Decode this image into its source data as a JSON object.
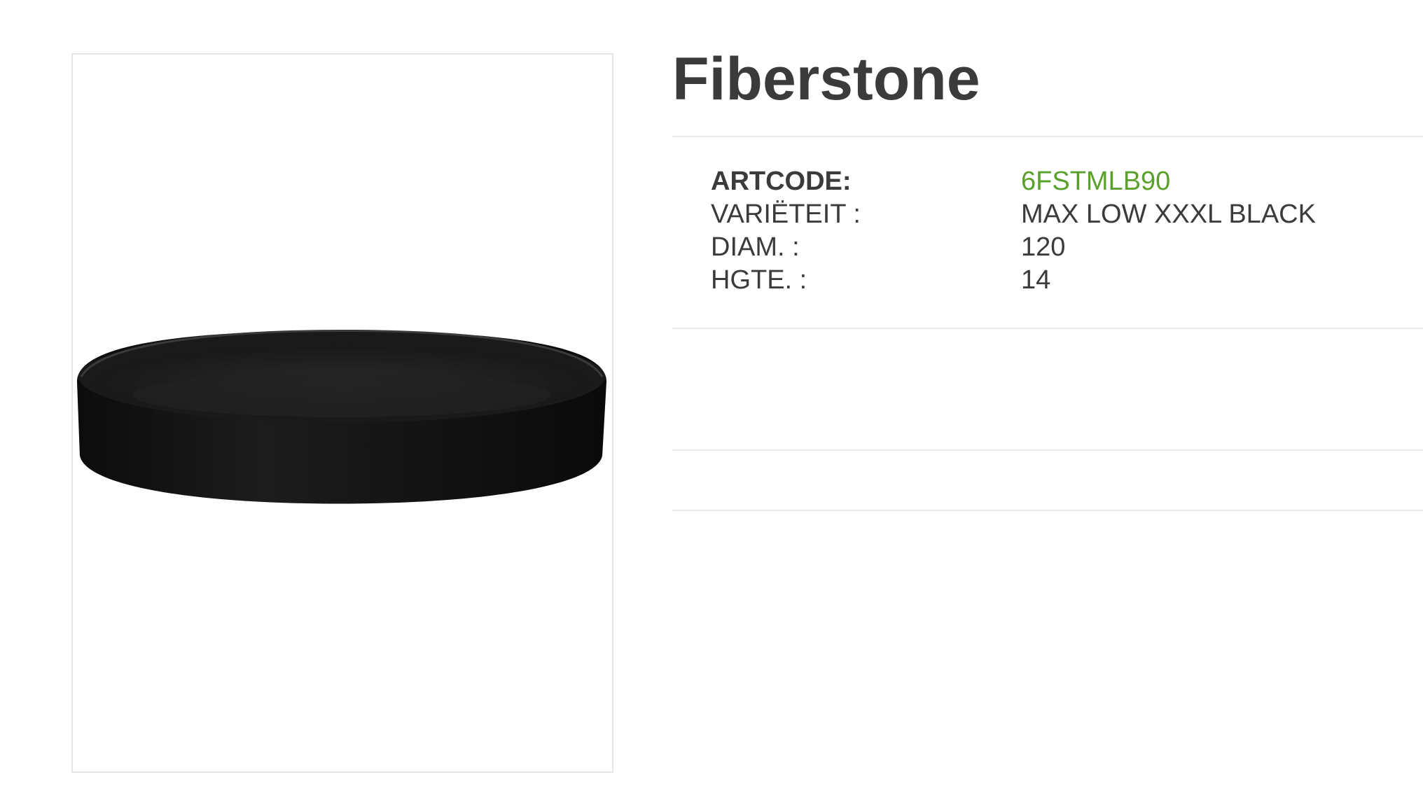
{
  "product": {
    "title": "Fiberstone",
    "image_description_icon": "black-round-saucer-image"
  },
  "specs": [
    {
      "label": "ARTCODE:",
      "value": "6FSTMLB90"
    },
    {
      "label": "VARIËTEIT :",
      "value": "MAX LOW XXXL BLACK"
    },
    {
      "label": "DIAM. :",
      "value": "120"
    },
    {
      "label": "HGTE. :",
      "value": "14"
    }
  ],
  "colors": {
    "text": "#3b3b3b",
    "accent_green": "#5aa02c",
    "divider": "#e9e9e9",
    "frame_border": "#e6e6e6"
  }
}
